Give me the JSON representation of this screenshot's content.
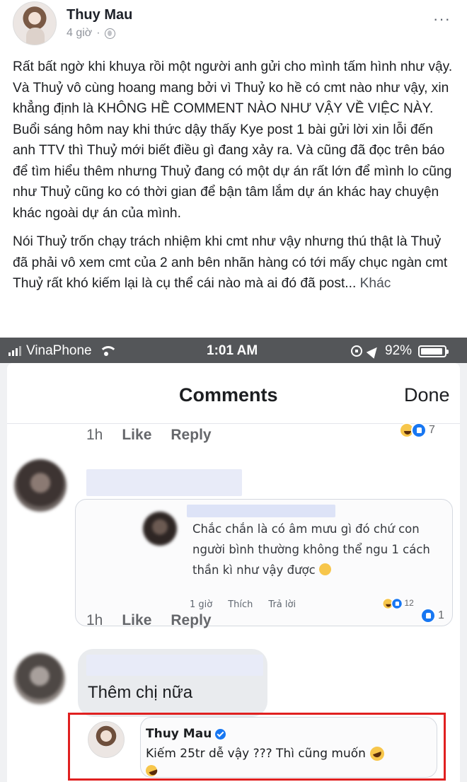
{
  "post": {
    "author": "Thuy Mau",
    "time": "4 giờ",
    "separator": "·",
    "more": "···",
    "paragraph1": "Rất bất ngờ khi khuya rồi một người anh gửi cho mình tấm hình như vậy. Và Thuỷ vô cùng hoang mang bởi vì Thuỷ ko hề có cmt nào như vậy, xin khẳng định là KHÔNG HỀ COMMENT NÀO NHƯ VẬY VỀ VIỆC NÀY. Buổi sáng hôm nay khi thức dậy thấy Kye post 1 bài gửi lời xin lỗi đến anh TTV thì Thuỷ mới biết điều gì đang xảy ra. Và cũng đã đọc trên báo để tìm hiểu thêm nhưng Thuỷ đang có một dự án rất lớn để mình lo cũng như Thuỷ cũng ko có thời gian để bận tâm lắm dự án khác hay chuyện khác ngoài dự án của mình.",
    "paragraph2": "Nói Thuỷ trốn chạy trách nhiệm khi cmt như vậy nhưng thú thật là Thuỷ đã phải vô xem cmt của 2 anh bên nhãn hàng có tới mấy chục ngàn cmt Thuỷ rất khó kiếm lại là cụ thể cái nào mà ai đó đã post...",
    "see_more": "Khác"
  },
  "embedded": {
    "status_bar": {
      "carrier": "VinaPhone",
      "time": "1:01 AM",
      "battery": "92%"
    },
    "header": {
      "title": "Comments",
      "done": "Done"
    },
    "row1": {
      "time": "1h",
      "like": "Like",
      "reply": "Reply",
      "reactions": "7"
    },
    "nested_comment": {
      "text": "Chắc chắn là có âm mưu gì đó chứ con người bình thường không thể ngu 1 cách thần kì như vậy được",
      "time": "1 giờ",
      "like": "Thích",
      "reply": "Trả lời",
      "reactions": "12"
    },
    "row2": {
      "time": "1h",
      "like": "Like",
      "reply": "Reply",
      "reactions": "1"
    },
    "comment3": {
      "text": "Thêm chị nữa"
    },
    "highlighted_reply": {
      "name": "Thuy Mau",
      "text": "Kiếm 25tr dễ vậy ??? Thì cũng muốn"
    }
  }
}
